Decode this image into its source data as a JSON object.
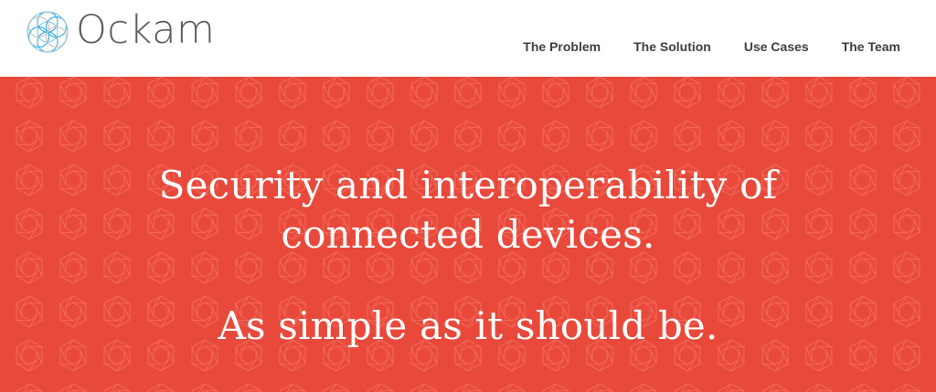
{
  "brand": {
    "name": "Ockam",
    "logo_icon": "flower-of-life-icon",
    "logo_colors": [
      "#3fb3e0",
      "#9ac9d9",
      "#c7c7c7"
    ]
  },
  "nav": {
    "items": [
      {
        "label": "The Problem"
      },
      {
        "label": "The Solution"
      },
      {
        "label": "Use Cases"
      },
      {
        "label": "The Team"
      }
    ]
  },
  "hero": {
    "headline_line1": "Security and interoperability of",
    "headline_line2": "connected devices.",
    "tagline": "As simple as it should be.",
    "background_color": "#e8493a",
    "pattern_icon": "hexagon-pattern-icon"
  }
}
